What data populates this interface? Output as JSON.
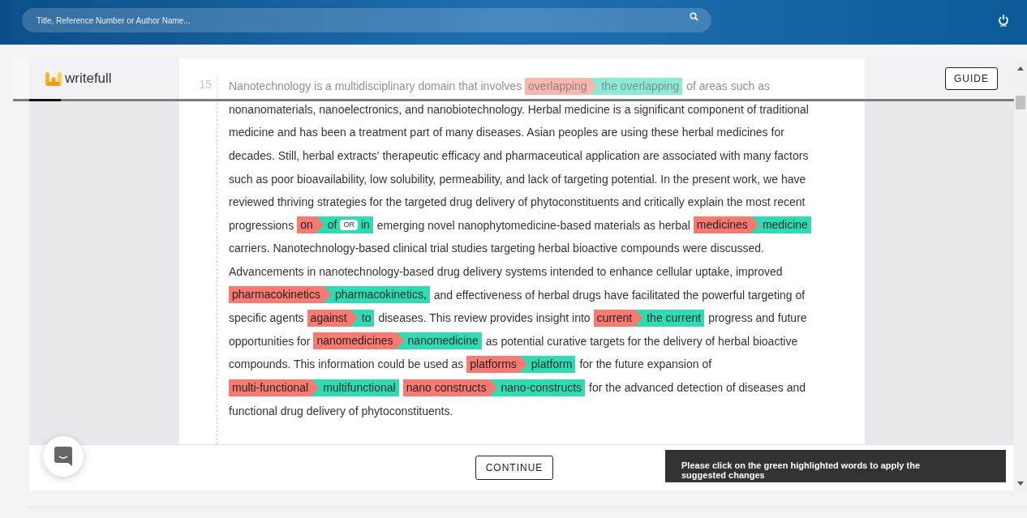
{
  "search": {
    "placeholder": "Title, Reference Number or Author Name..."
  },
  "header": {
    "logo": "writefull",
    "guide_button": "GUIDE"
  },
  "document": {
    "line_number": "15",
    "lines": [
      [
        {
          "kind": "text",
          "text": "Nanotechnology is a multidisciplinary domain that involves"
        },
        {
          "kind": "suggestion",
          "original": "overlapping",
          "options": [
            "the overlapping"
          ]
        },
        {
          "kind": "text",
          "text": "of areas such as"
        }
      ],
      [
        {
          "kind": "text",
          "text": "nonanomaterials, nanoelectronics, and nanobiotechnology. Herbal medicine is a significant component of traditional"
        }
      ],
      [
        {
          "kind": "text",
          "text": "medicine and has been a treatment part of many diseases. Asian peoples are using these herbal medicines for"
        }
      ],
      [
        {
          "kind": "text",
          "text": "decades. Still, herbal extracts' therapeutic efficacy and pharmaceutical application are associated with many factors"
        }
      ],
      [
        {
          "kind": "text",
          "text": "such as poor bioavailability, low solubility, permeability, and lack of targeting potential. In the present work, we have"
        }
      ],
      [
        {
          "kind": "text",
          "text": "reviewed thriving strategies for the targeted drug delivery of phytoconstituents and critically explain the most recent"
        }
      ],
      [
        {
          "kind": "text",
          "text": "progressions"
        },
        {
          "kind": "suggestion",
          "original": "on",
          "options": [
            "of",
            "in"
          ],
          "separator": "OR"
        },
        {
          "kind": "text",
          "text": "emerging novel nanophytomedicine-based materials as herbal"
        },
        {
          "kind": "suggestion",
          "original": "medicines",
          "options": [
            "medicine"
          ]
        }
      ],
      [
        {
          "kind": "text",
          "text": "carriers. Nanotechnology-based clinical trial studies targeting herbal bioactive compounds were discussed."
        }
      ],
      [
        {
          "kind": "text",
          "text": "Advancements in nanotechnology-based drug delivery systems intended to enhance cellular uptake, improved"
        }
      ],
      [
        {
          "kind": "suggestion",
          "original": "pharmacokinetics",
          "options": [
            "pharmacokinetics,"
          ]
        },
        {
          "kind": "text",
          "text": "and effectiveness of herbal drugs have facilitated the powerful targeting of"
        }
      ],
      [
        {
          "kind": "text",
          "text": "specific agents"
        },
        {
          "kind": "suggestion",
          "original": "against",
          "options": [
            "to"
          ]
        },
        {
          "kind": "text",
          "text": "diseases. This review provides insight into"
        },
        {
          "kind": "suggestion",
          "original": "current",
          "options": [
            "the current"
          ]
        },
        {
          "kind": "text",
          "text": "progress and future"
        }
      ],
      [
        {
          "kind": "text",
          "text": "opportunities for"
        },
        {
          "kind": "suggestion",
          "original": "nanomedicines",
          "options": [
            "nanomedicine"
          ]
        },
        {
          "kind": "text",
          "text": "as potential curative targets for the delivery of herbal bioactive"
        }
      ],
      [
        {
          "kind": "text",
          "text": "compounds. This information could be used as"
        },
        {
          "kind": "suggestion",
          "original": "platforms",
          "options": [
            "platform"
          ]
        },
        {
          "kind": "text",
          "text": "for the future expansion of"
        }
      ],
      [
        {
          "kind": "suggestion",
          "original": "multi-functional",
          "options": [
            "multifunctional"
          ]
        },
        {
          "kind": "suggestion",
          "original": "nano constructs",
          "options": [
            "nano-constructs"
          ]
        },
        {
          "kind": "text",
          "text": "for the advanced detection of diseases and"
        }
      ],
      [
        {
          "kind": "text",
          "text": "functional drug delivery of phytoconstituents."
        }
      ]
    ]
  },
  "footer": {
    "continue_button": "CONTINUE"
  },
  "toast": "Please click on the green highlighted words to apply the suggested changes"
}
